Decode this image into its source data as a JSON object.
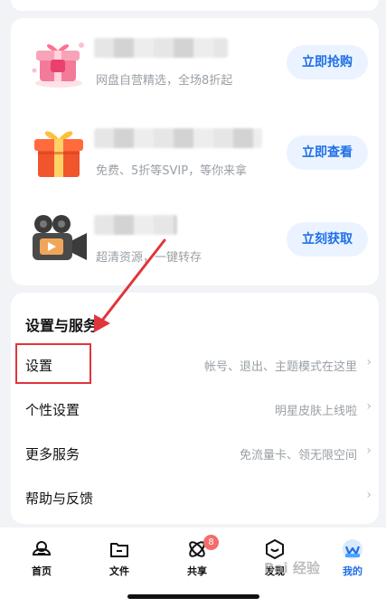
{
  "promos": [
    {
      "subtitle": "网盘自营精选，全场8折起",
      "button": "立即抢购",
      "icon": "gift-box-pink-icon"
    },
    {
      "subtitle": "免费、5折等SVIP，等你来拿",
      "button": "立即查看",
      "icon": "gift-box-orange-icon"
    },
    {
      "subtitle": "超清资源，一键转存",
      "button": "立刻获取",
      "icon": "movie-camera-icon"
    }
  ],
  "services": {
    "title": "设置与服务",
    "rows": [
      {
        "label": "设置",
        "desc": "帐号、退出、主题模式在这里"
      },
      {
        "label": "个性设置",
        "desc": "明星皮肤上线啦"
      },
      {
        "label": "更多服务",
        "desc": "免流量卡、领无限空间"
      },
      {
        "label": "帮助与反馈",
        "desc": ""
      }
    ]
  },
  "tabbar": {
    "tabs": [
      {
        "label": "首页",
        "icon": "home-icon"
      },
      {
        "label": "文件",
        "icon": "folder-icon"
      },
      {
        "label": "共享",
        "icon": "share-icon"
      },
      {
        "label": "发现",
        "icon": "discover-icon"
      },
      {
        "label": "我的",
        "icon": "profile-avatar-icon"
      }
    ],
    "share_badge": "8"
  },
  "watermark": "Bai 经验",
  "colors": {
    "accent": "#1f6fe8",
    "annotation": "#e0353a",
    "badge": "#f56c6c"
  }
}
